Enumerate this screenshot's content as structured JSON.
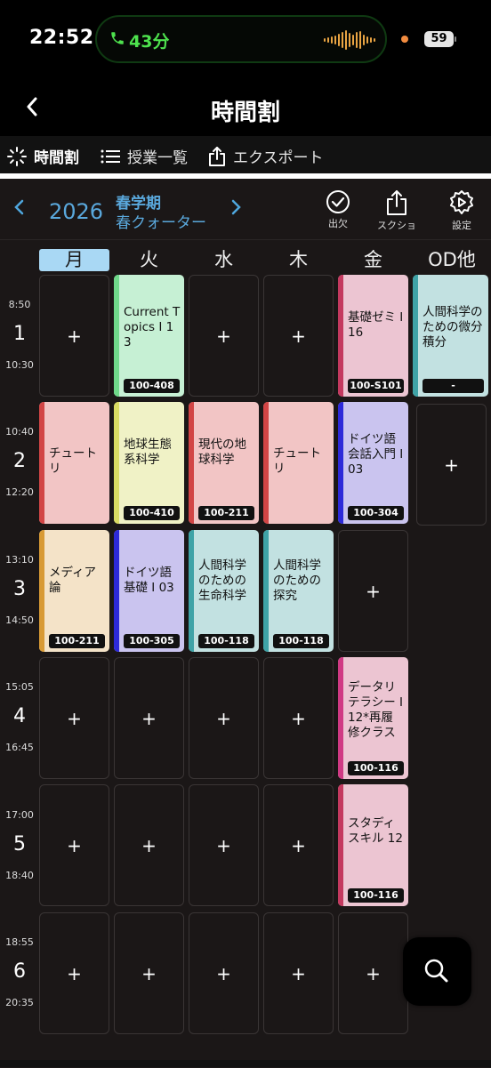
{
  "status_bar": {
    "time": "22:52",
    "call_duration": "43分",
    "battery": "59"
  },
  "nav": {
    "title": "時間割"
  },
  "tabs": [
    {
      "label": "時間割",
      "icon": "spinner-icon",
      "active": true
    },
    {
      "label": "授業一覧",
      "icon": "list-icon",
      "active": false
    },
    {
      "label": "エクスポート",
      "icon": "share-icon",
      "active": false
    }
  ],
  "term_header": {
    "year": "2026",
    "semester": "春学期",
    "quarter": "春クォーター",
    "buttons": {
      "attendance": "出欠",
      "screenshot": "スクショ",
      "settings": "設定"
    }
  },
  "days": [
    "月",
    "火",
    "水",
    "木",
    "金",
    "OD他"
  ],
  "periods": [
    {
      "number": "1",
      "start": "8:50",
      "end": "10:30"
    },
    {
      "number": "2",
      "start": "10:40",
      "end": "12:20"
    },
    {
      "number": "3",
      "start": "13:10",
      "end": "14:50"
    },
    {
      "number": "4",
      "start": "15:05",
      "end": "16:45"
    },
    {
      "number": "5",
      "start": "17:00",
      "end": "18:40"
    },
    {
      "number": "6",
      "start": "18:55",
      "end": "20:35"
    }
  ],
  "empty_label": "+",
  "courses": [
    {
      "name": "Current Topics I 13",
      "room": "100-408",
      "bg": "#c6f0d4",
      "bar": "#6fd98a"
    },
    {
      "name": "基礎ゼミ I 16",
      "room": "100-S101",
      "bg": "#ecc5d2",
      "bar": "#c4395f"
    },
    {
      "name": "人間科学のための微分積分",
      "room": "-",
      "bg": "#c2e1e1",
      "bar": "#3fa3a7"
    },
    {
      "name": "チュートリ",
      "room": "",
      "bg": "#f2c5c5",
      "bar": "#d24545"
    },
    {
      "name": "地球生態系科学",
      "room": "100-410",
      "bg": "#f0f2c6",
      "bar": "#d9dc63"
    },
    {
      "name": "現代の地球科学",
      "room": "100-211",
      "bg": "#f2c5c5",
      "bar": "#d24545"
    },
    {
      "name": "チュートリ",
      "room": "",
      "bg": "#f2c5c5",
      "bar": "#d24545"
    },
    {
      "name": "ドイツ語会話入門 I 03",
      "room": "100-304",
      "bg": "#cac4ef",
      "bar": "#2d2ad9"
    },
    {
      "name": "メディア論",
      "room": "100-211",
      "bg": "#f4e3c8",
      "bar": "#d89a35"
    },
    {
      "name": "ドイツ語基礎 I 03",
      "room": "100-305",
      "bg": "#cac4ef",
      "bar": "#2d2ad9"
    },
    {
      "name": "人間科学のための生命科学",
      "room": "100-118",
      "bg": "#c2e1e1",
      "bar": "#3fa3a7"
    },
    {
      "name": "人間科学のための探究",
      "room": "100-118",
      "bg": "#c2e1e1",
      "bar": "#3fa3a7"
    },
    {
      "name": "データリテラシー I 12*再履修クラス",
      "room": "100-116",
      "bg": "#ecc5d2",
      "bar": "#d03a84"
    },
    {
      "name": "スタディスキル 12",
      "room": "100-116",
      "bg": "#ecc5d2",
      "bar": "#c4395f"
    }
  ]
}
